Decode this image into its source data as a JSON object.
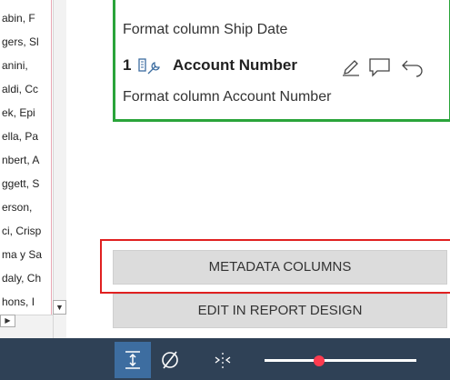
{
  "left_list": {
    "items": [
      "abin, F",
      "gers, Sl",
      "anini, ",
      "aldi, Cc",
      "ek, Epi",
      "ella, Pa",
      "nbert, A",
      "ggett, S",
      "erson, ",
      "ci, Crisp",
      "ma y Sa",
      "daly, Ch",
      "hons, I"
    ]
  },
  "step_card": {
    "prev_description": "Format column Ship Date",
    "step_number": "1",
    "step_name": "Account Number",
    "description": "Format column Account Number"
  },
  "buttons": {
    "metadata_columns": "METADATA COLUMNS",
    "edit_in_report_design": "EDIT IN REPORT DESIGN"
  },
  "icons": {
    "wrench": "wrench-icon",
    "pencil": "pencil-icon",
    "comment": "comment-icon",
    "undo": "undo-icon",
    "fit": "fit-height-icon",
    "null": "null-icon",
    "collapse": "collapse-columns-icon"
  },
  "colors": {
    "card_border": "#2aa43a",
    "highlight": "#e02020",
    "toolbar_bg": "#2f4156",
    "toolbar_active": "#3d6da0",
    "slider_thumb": "#ff3b4f"
  },
  "zoom_slider": {
    "value": 0.36
  }
}
